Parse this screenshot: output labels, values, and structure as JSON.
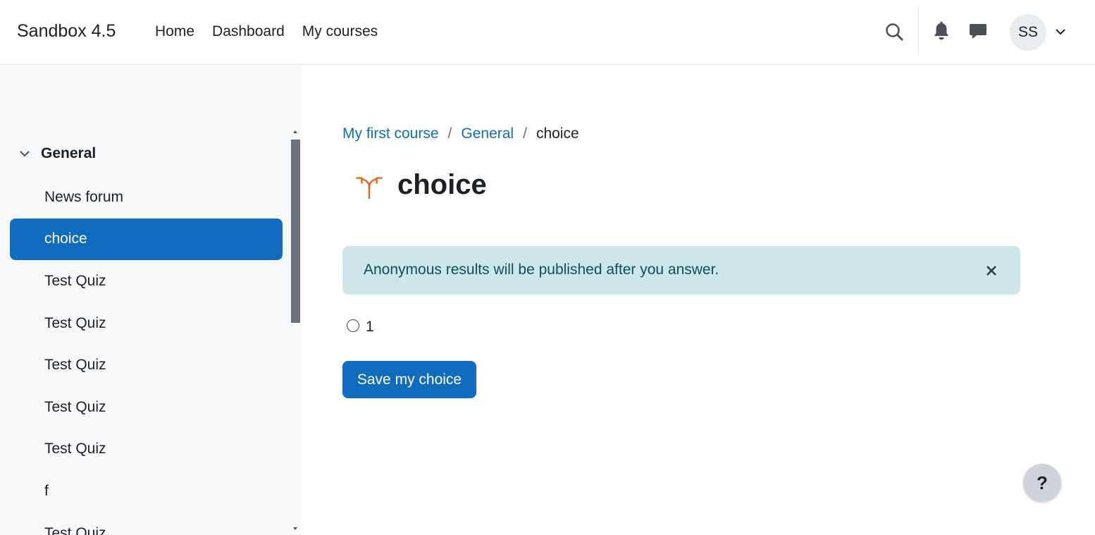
{
  "header": {
    "brand": "Sandbox 4.5",
    "nav": [
      "Home",
      "Dashboard",
      "My courses"
    ],
    "user_initials": "SS",
    "icons": [
      "search-icon",
      "bell-icon",
      "chat-icon",
      "chevron-down-icon"
    ]
  },
  "sidebar": {
    "section_title": "General",
    "items": [
      {
        "label": "News forum",
        "active": false
      },
      {
        "label": "choice",
        "active": true
      },
      {
        "label": "Test Quiz",
        "active": false
      },
      {
        "label": "Test Quiz",
        "active": false
      },
      {
        "label": "Test Quiz",
        "active": false
      },
      {
        "label": "Test Quiz",
        "active": false
      },
      {
        "label": "Test Quiz",
        "active": false
      },
      {
        "label": "f",
        "active": false
      },
      {
        "label": "Test Quiz",
        "active": false
      }
    ]
  },
  "breadcrumb": {
    "items": [
      "My first course",
      "General"
    ],
    "current": "choice",
    "separator": "/"
  },
  "page": {
    "title": "choice",
    "icon": "choice-split-arrow-icon",
    "icon_color": "#e8630a",
    "alert_text": "Anonymous results will be published after you answer.",
    "options": [
      {
        "label": "1",
        "selected": false
      }
    ],
    "save_label": "Save my choice"
  },
  "help_label": "?",
  "colors": {
    "primary": "#0f6cbf",
    "alert_bg": "#cce6ea",
    "sidebar_bg": "#f7f8fa"
  }
}
